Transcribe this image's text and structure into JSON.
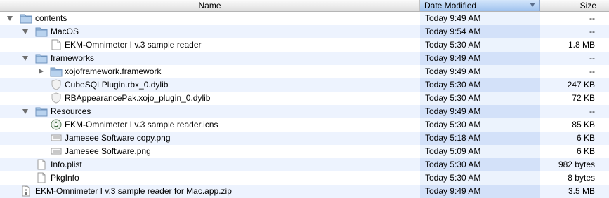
{
  "columns": {
    "name": "Name",
    "date": "Date Modified",
    "size": "Size"
  },
  "rows": [
    {
      "name": "contents",
      "date": "Today 9:49 AM",
      "size": "--"
    },
    {
      "name": "MacOS",
      "date": "Today 9:54 AM",
      "size": "--"
    },
    {
      "name": "EKM-Omnimeter I v.3 sample reader",
      "date": "Today 5:30 AM",
      "size": "1.8 MB"
    },
    {
      "name": "frameworks",
      "date": "Today 9:49 AM",
      "size": "--"
    },
    {
      "name": "xojoframework.framework",
      "date": "Today 9:49 AM",
      "size": "--"
    },
    {
      "name": "CubeSQLPlugin.rbx_0.dylib",
      "date": "Today 5:30 AM",
      "size": "247 KB"
    },
    {
      "name": "RBAppearancePak.xojo_plugin_0.dylib",
      "date": "Today 5:30 AM",
      "size": "72 KB"
    },
    {
      "name": "Resources",
      "date": "Today 9:49 AM",
      "size": "--"
    },
    {
      "name": "EKM-Omnimeter I v.3 sample reader.icns",
      "date": "Today 5:30 AM",
      "size": "85 KB"
    },
    {
      "name": "Jamesee Software copy.png",
      "date": "Today 5:18 AM",
      "size": "6 KB"
    },
    {
      "name": "Jamesee Software.png",
      "date": "Today 5:09 AM",
      "size": "6 KB"
    },
    {
      "name": "Info.plist",
      "date": "Today 5:30 AM",
      "size": "982 bytes"
    },
    {
      "name": "PkgInfo",
      "date": "Today 5:30 AM",
      "size": "8 bytes"
    },
    {
      "name": "EKM-Omnimeter I v.3 sample reader for Mac.app.zip",
      "date": "Today 9:49 AM",
      "size": "3.5 MB"
    }
  ],
  "icons": [
    "folder-icon",
    "folder-icon",
    "executable-icon",
    "folder-icon",
    "folder-icon",
    "dylib-icon",
    "dylib-icon",
    "folder-icon",
    "icns-icon",
    "png-icon",
    "png-icon",
    "document-icon",
    "document-icon",
    "zip-icon"
  ],
  "disclosure": [
    "expanded",
    "expanded",
    "none",
    "expanded",
    "collapsed",
    "none",
    "none",
    "expanded",
    "none",
    "none",
    "none",
    "none",
    "none",
    "none"
  ],
  "sort": {
    "column": "date",
    "direction": "descending"
  }
}
